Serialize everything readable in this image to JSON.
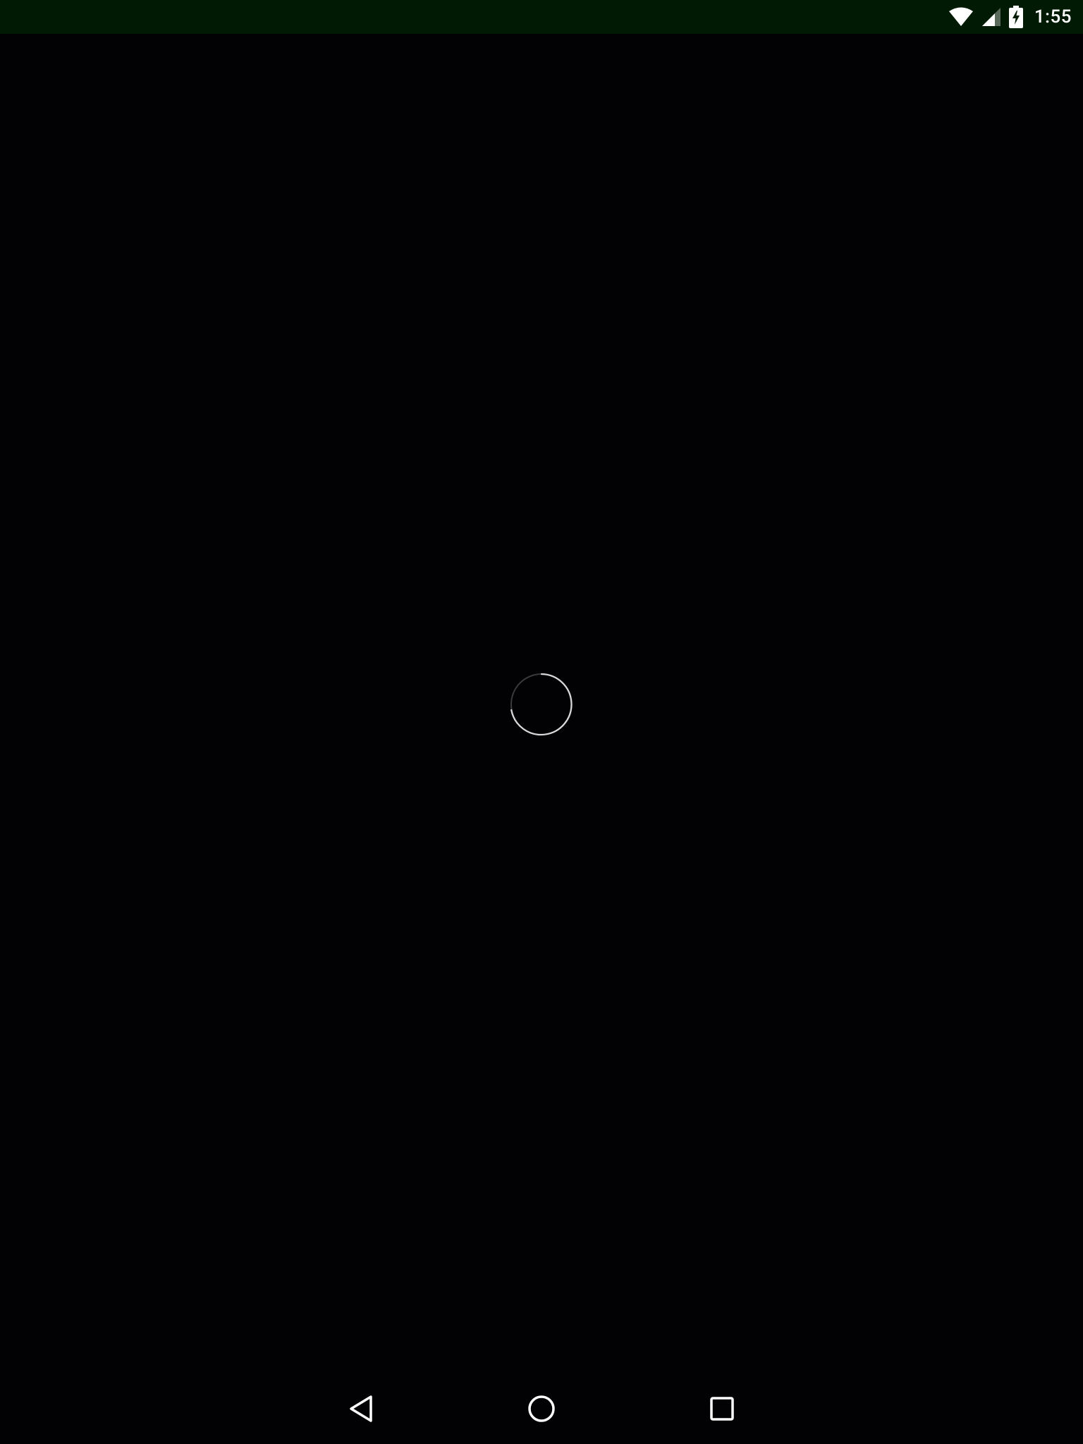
{
  "status_bar": {
    "time": "1:55",
    "icons": [
      "wifi-icon",
      "cellular-signal-icon",
      "battery-charging-icon"
    ]
  },
  "content": {
    "loading_indicator": "spinner"
  },
  "nav_bar": {
    "buttons": [
      "back-icon",
      "home-icon",
      "recents-icon"
    ]
  },
  "colors": {
    "status_bar_bg": "#001a04",
    "screen_bg": "#020103",
    "icon_color": "#ffffff"
  }
}
